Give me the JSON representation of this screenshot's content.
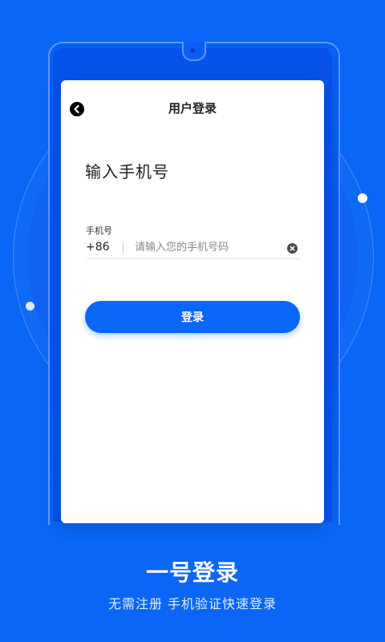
{
  "login_card": {
    "title": "用户登录",
    "heading": "输入手机号",
    "phone_label": "手机号",
    "country_code": "+86",
    "phone_value": "",
    "phone_placeholder": "请输入您的手机号码",
    "login_button": "登录"
  },
  "promo": {
    "title": "一号登录",
    "subtitle": "无需注册  手机验证快速登录"
  },
  "colors": {
    "background": "#0a66f6",
    "card": "#ffffff",
    "button": "#0a66f6"
  },
  "icons": {
    "back": "chevron-left-icon",
    "clear": "clear-icon"
  }
}
